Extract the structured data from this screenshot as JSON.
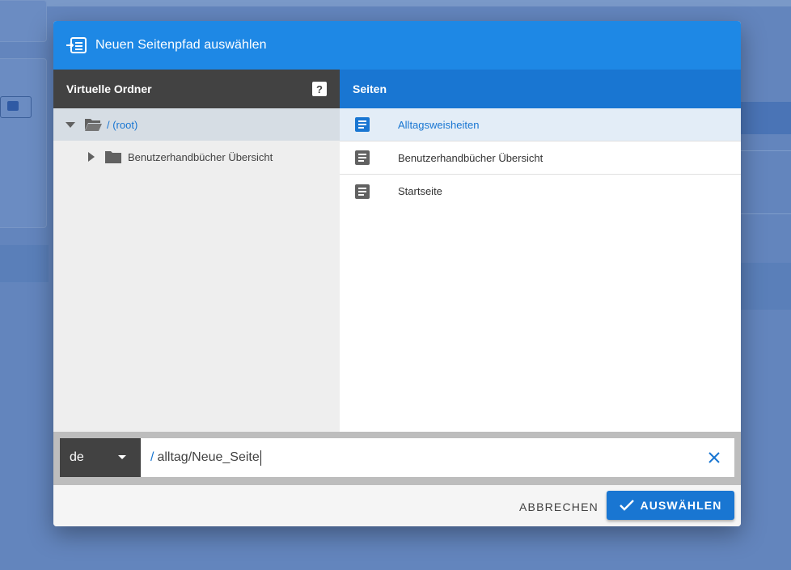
{
  "dialog": {
    "title": "Neuen Seitenpfad auswählen",
    "header_icon": "page-path-icon"
  },
  "left_pane": {
    "title": "Virtuelle Ordner",
    "help_label": "?",
    "tree": {
      "root": {
        "label": "/ (root)",
        "icon": "folder-open-icon",
        "expanded": true
      },
      "children": [
        {
          "label": "Benutzerhandbücher Übersicht",
          "icon": "folder-icon",
          "expanded": false
        }
      ]
    }
  },
  "right_pane": {
    "title": "Seiten",
    "pages": [
      {
        "label": "Alltagsweisheiten",
        "icon": "page-icon",
        "active": true
      },
      {
        "label": "Benutzerhandbücher Übersicht",
        "icon": "page-icon",
        "active": false
      },
      {
        "label": "Startseite",
        "icon": "page-icon",
        "active": false
      }
    ]
  },
  "path_bar": {
    "locale": "de",
    "slash": "/",
    "value": "alltag/Neue_Seite"
  },
  "footer": {
    "cancel_label": "ABBRECHEN",
    "select_label": "AUSWÄHLEN"
  },
  "colors": {
    "primary": "#1976d2",
    "header": "#1e88e5",
    "dark": "#424242"
  }
}
